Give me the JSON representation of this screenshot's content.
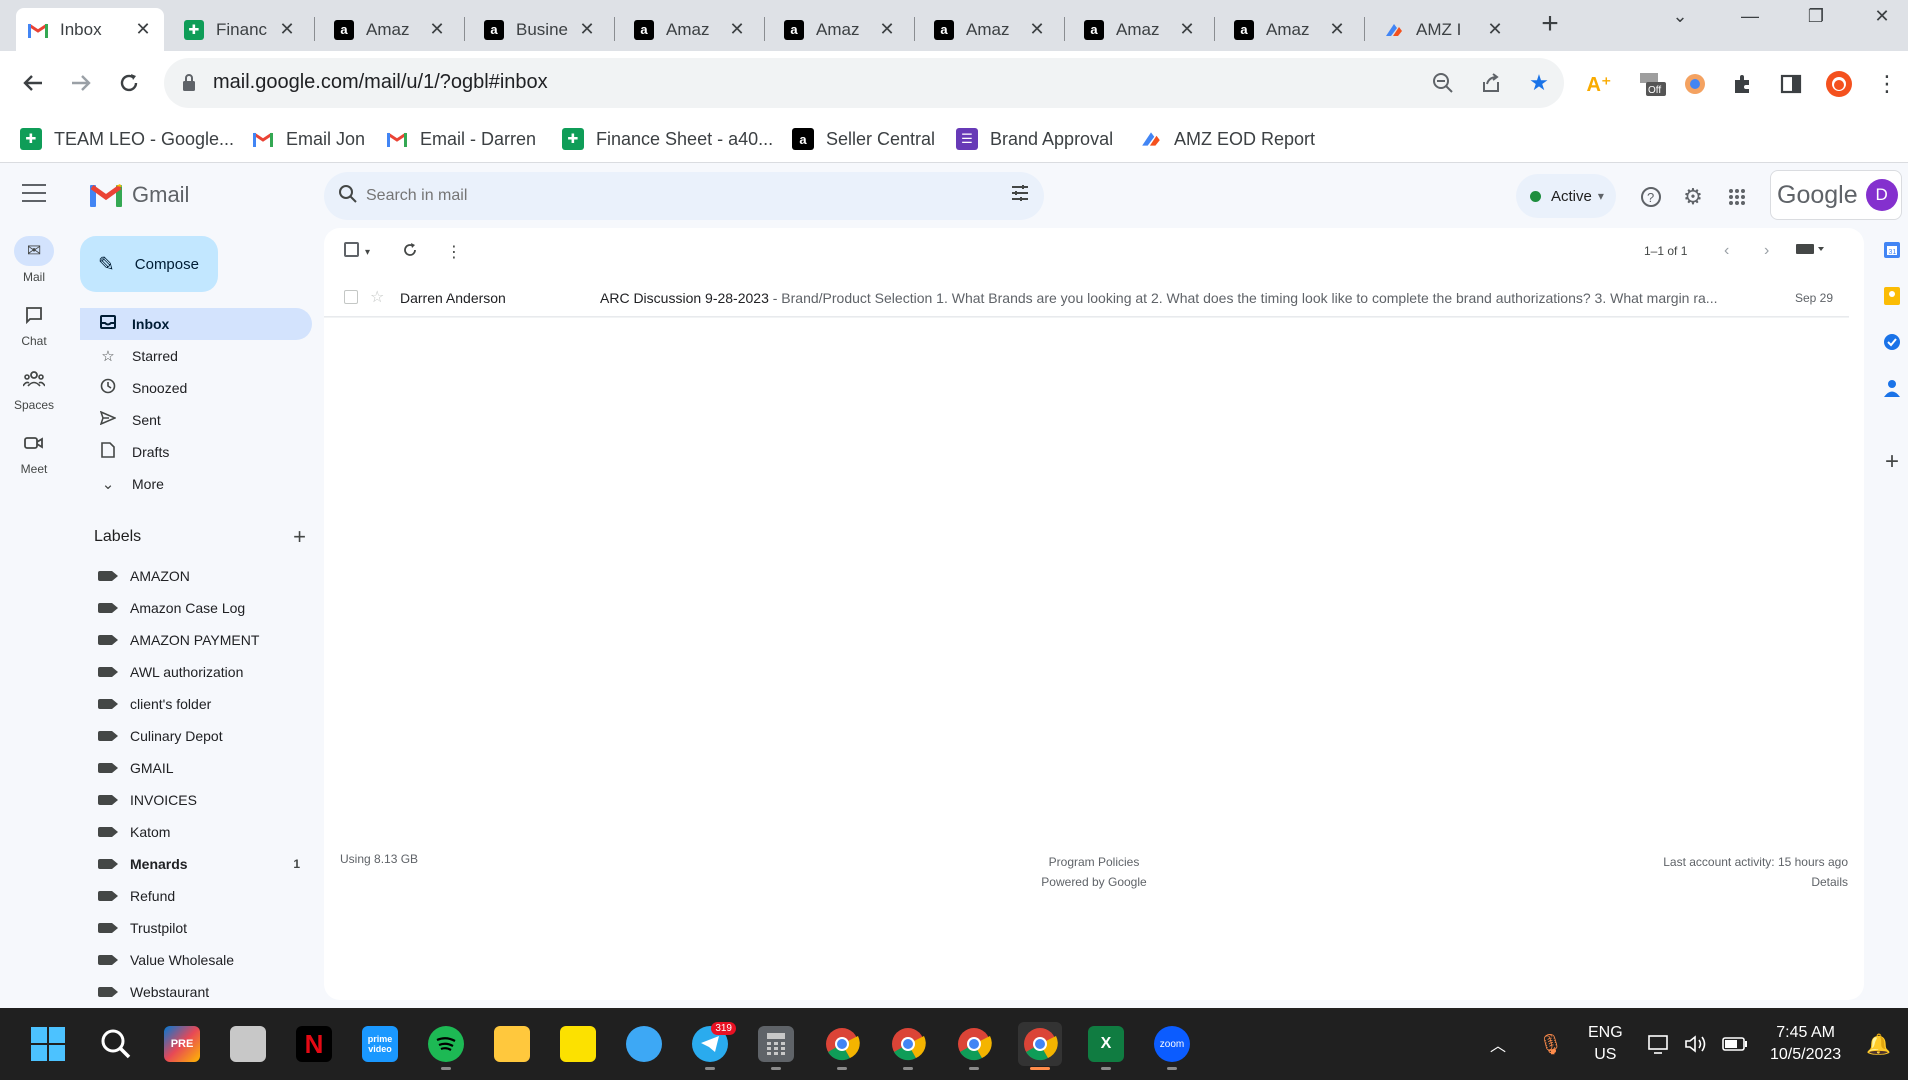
{
  "browser": {
    "tabs": [
      {
        "title": "Inbox",
        "favicon": "gmail-icon",
        "active": true
      },
      {
        "title": "Financ",
        "favicon": "sheets-icon",
        "active": false
      },
      {
        "title": "Amaz",
        "favicon": "amazon-icon",
        "active": false
      },
      {
        "title": "Busine",
        "favicon": "amazon-icon",
        "active": false
      },
      {
        "title": "Amaz",
        "favicon": "amazon-icon",
        "active": false
      },
      {
        "title": "Amaz",
        "favicon": "amazon-icon",
        "active": false
      },
      {
        "title": "Amaz",
        "favicon": "amazon-icon",
        "active": false
      },
      {
        "title": "Amaz",
        "favicon": "amazon-icon",
        "active": false
      },
      {
        "title": "Amaz",
        "favicon": "amazon-icon",
        "active": false
      },
      {
        "title": "AMZ I",
        "favicon": "amz-report-icon",
        "active": false
      }
    ],
    "close_glyph": "✕",
    "new_tab_glyph": "+",
    "url": "mail.google.com/mail/u/1/?ogbl#inbox",
    "bookmarks": [
      {
        "label": "TEAM LEO - Google...",
        "favicon": "sheets-icon"
      },
      {
        "label": "Email Jon",
        "favicon": "gmail-icon"
      },
      {
        "label": "Email - Darren",
        "favicon": "gmail-icon"
      },
      {
        "label": "Finance Sheet - a40...",
        "favicon": "sheets-icon"
      },
      {
        "label": "Seller Central",
        "favicon": "amazon-icon"
      },
      {
        "label": "Brand Approval",
        "favicon": "forms-icon"
      },
      {
        "label": "AMZ EOD Report",
        "favicon": "amz-report-icon"
      }
    ]
  },
  "gmail": {
    "wordmark": "Gmail",
    "search_placeholder": "Search in mail",
    "status": "Active",
    "google_text": "Google",
    "avatar_letter": "D",
    "rail": [
      {
        "label": "Mail",
        "icon": "mail-icon",
        "active": true
      },
      {
        "label": "Chat",
        "icon": "chat-icon",
        "active": false
      },
      {
        "label": "Spaces",
        "icon": "spaces-icon",
        "active": false
      },
      {
        "label": "Meet",
        "icon": "meet-icon",
        "active": false
      }
    ],
    "compose_label": "Compose",
    "nav": [
      {
        "label": "Inbox",
        "icon": "inbox-icon",
        "active": true
      },
      {
        "label": "Starred",
        "icon": "star-icon",
        "active": false
      },
      {
        "label": "Snoozed",
        "icon": "clock-icon",
        "active": false
      },
      {
        "label": "Sent",
        "icon": "send-icon",
        "active": false
      },
      {
        "label": "Drafts",
        "icon": "draft-icon",
        "active": false
      },
      {
        "label": "More",
        "icon": "chevron-down-icon",
        "active": false
      }
    ],
    "labels_title": "Labels",
    "labels": [
      {
        "name": "AMAZON",
        "bold": false,
        "count": ""
      },
      {
        "name": "Amazon Case Log",
        "bold": false,
        "count": ""
      },
      {
        "name": "AMAZON PAYMENT",
        "bold": false,
        "count": ""
      },
      {
        "name": "AWL authorization",
        "bold": false,
        "count": ""
      },
      {
        "name": "client's folder",
        "bold": false,
        "count": ""
      },
      {
        "name": "Culinary Depot",
        "bold": false,
        "count": ""
      },
      {
        "name": "GMAIL",
        "bold": false,
        "count": ""
      },
      {
        "name": "INVOICES",
        "bold": false,
        "count": ""
      },
      {
        "name": "Katom",
        "bold": false,
        "count": ""
      },
      {
        "name": "Menards",
        "bold": true,
        "count": "1"
      },
      {
        "name": "Refund",
        "bold": false,
        "count": ""
      },
      {
        "name": "Trustpilot",
        "bold": false,
        "count": ""
      },
      {
        "name": "Value Wholesale",
        "bold": false,
        "count": ""
      },
      {
        "name": "Webstaurant",
        "bold": false,
        "count": ""
      }
    ],
    "pager": "1–1 of 1",
    "emails": [
      {
        "sender": "Darren Anderson",
        "subject": "ARC Discussion 9-28-2023",
        "snippet": " - Brand/Product Selection 1. What Brands are you looking at 2. What does the timing look like to complete the brand authorizations? 3. What margin ra...",
        "date": "Sep 29"
      }
    ],
    "footer": {
      "storage": "Using 8.13 GB",
      "policies": "Program Policies",
      "powered": "Powered by Google",
      "activity": "Last account activity: 15 hours ago",
      "details": "Details"
    }
  },
  "taskbar": {
    "telegram_badge": "319",
    "lang_top": "ENG",
    "lang_bottom": "US",
    "time": "7:45 AM",
    "date": "10/5/2023",
    "zoom_label": "zoom",
    "prime_label": "prime video",
    "colors": {
      "accent": "#ff8c4b",
      "background": "#202020"
    }
  }
}
